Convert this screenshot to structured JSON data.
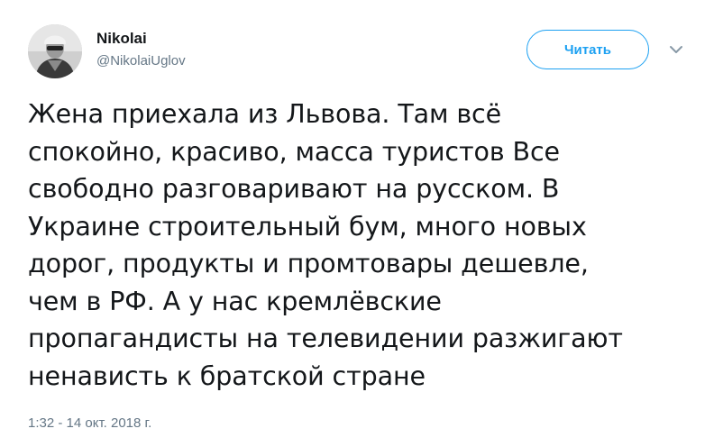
{
  "author": {
    "display_name": "Nikolai",
    "screen_name": "@NikolaiUglov"
  },
  "follow_button": {
    "label": "Читать"
  },
  "icons": {
    "caret": "chevron-down-icon",
    "avatar": "user-avatar"
  },
  "colors": {
    "accent": "#1da1f2",
    "text": "#14171a",
    "secondary": "#657786"
  },
  "tweet": {
    "lines": [
      "Жена приехала из Львова. Там всё",
      "спокойно, красиво, масса туристов Все",
      "свободно разговаривают на русском. В",
      "Украине строительный бум, много новых",
      "дорог, продукты и промтовары дешевле,",
      "чем в РФ. А у нас кремлёвские",
      "пропагандисты на телевидении разжигают",
      "ненависть к братской стране"
    ],
    "timestamp": "1:32 - 14 окт. 2018 г."
  }
}
